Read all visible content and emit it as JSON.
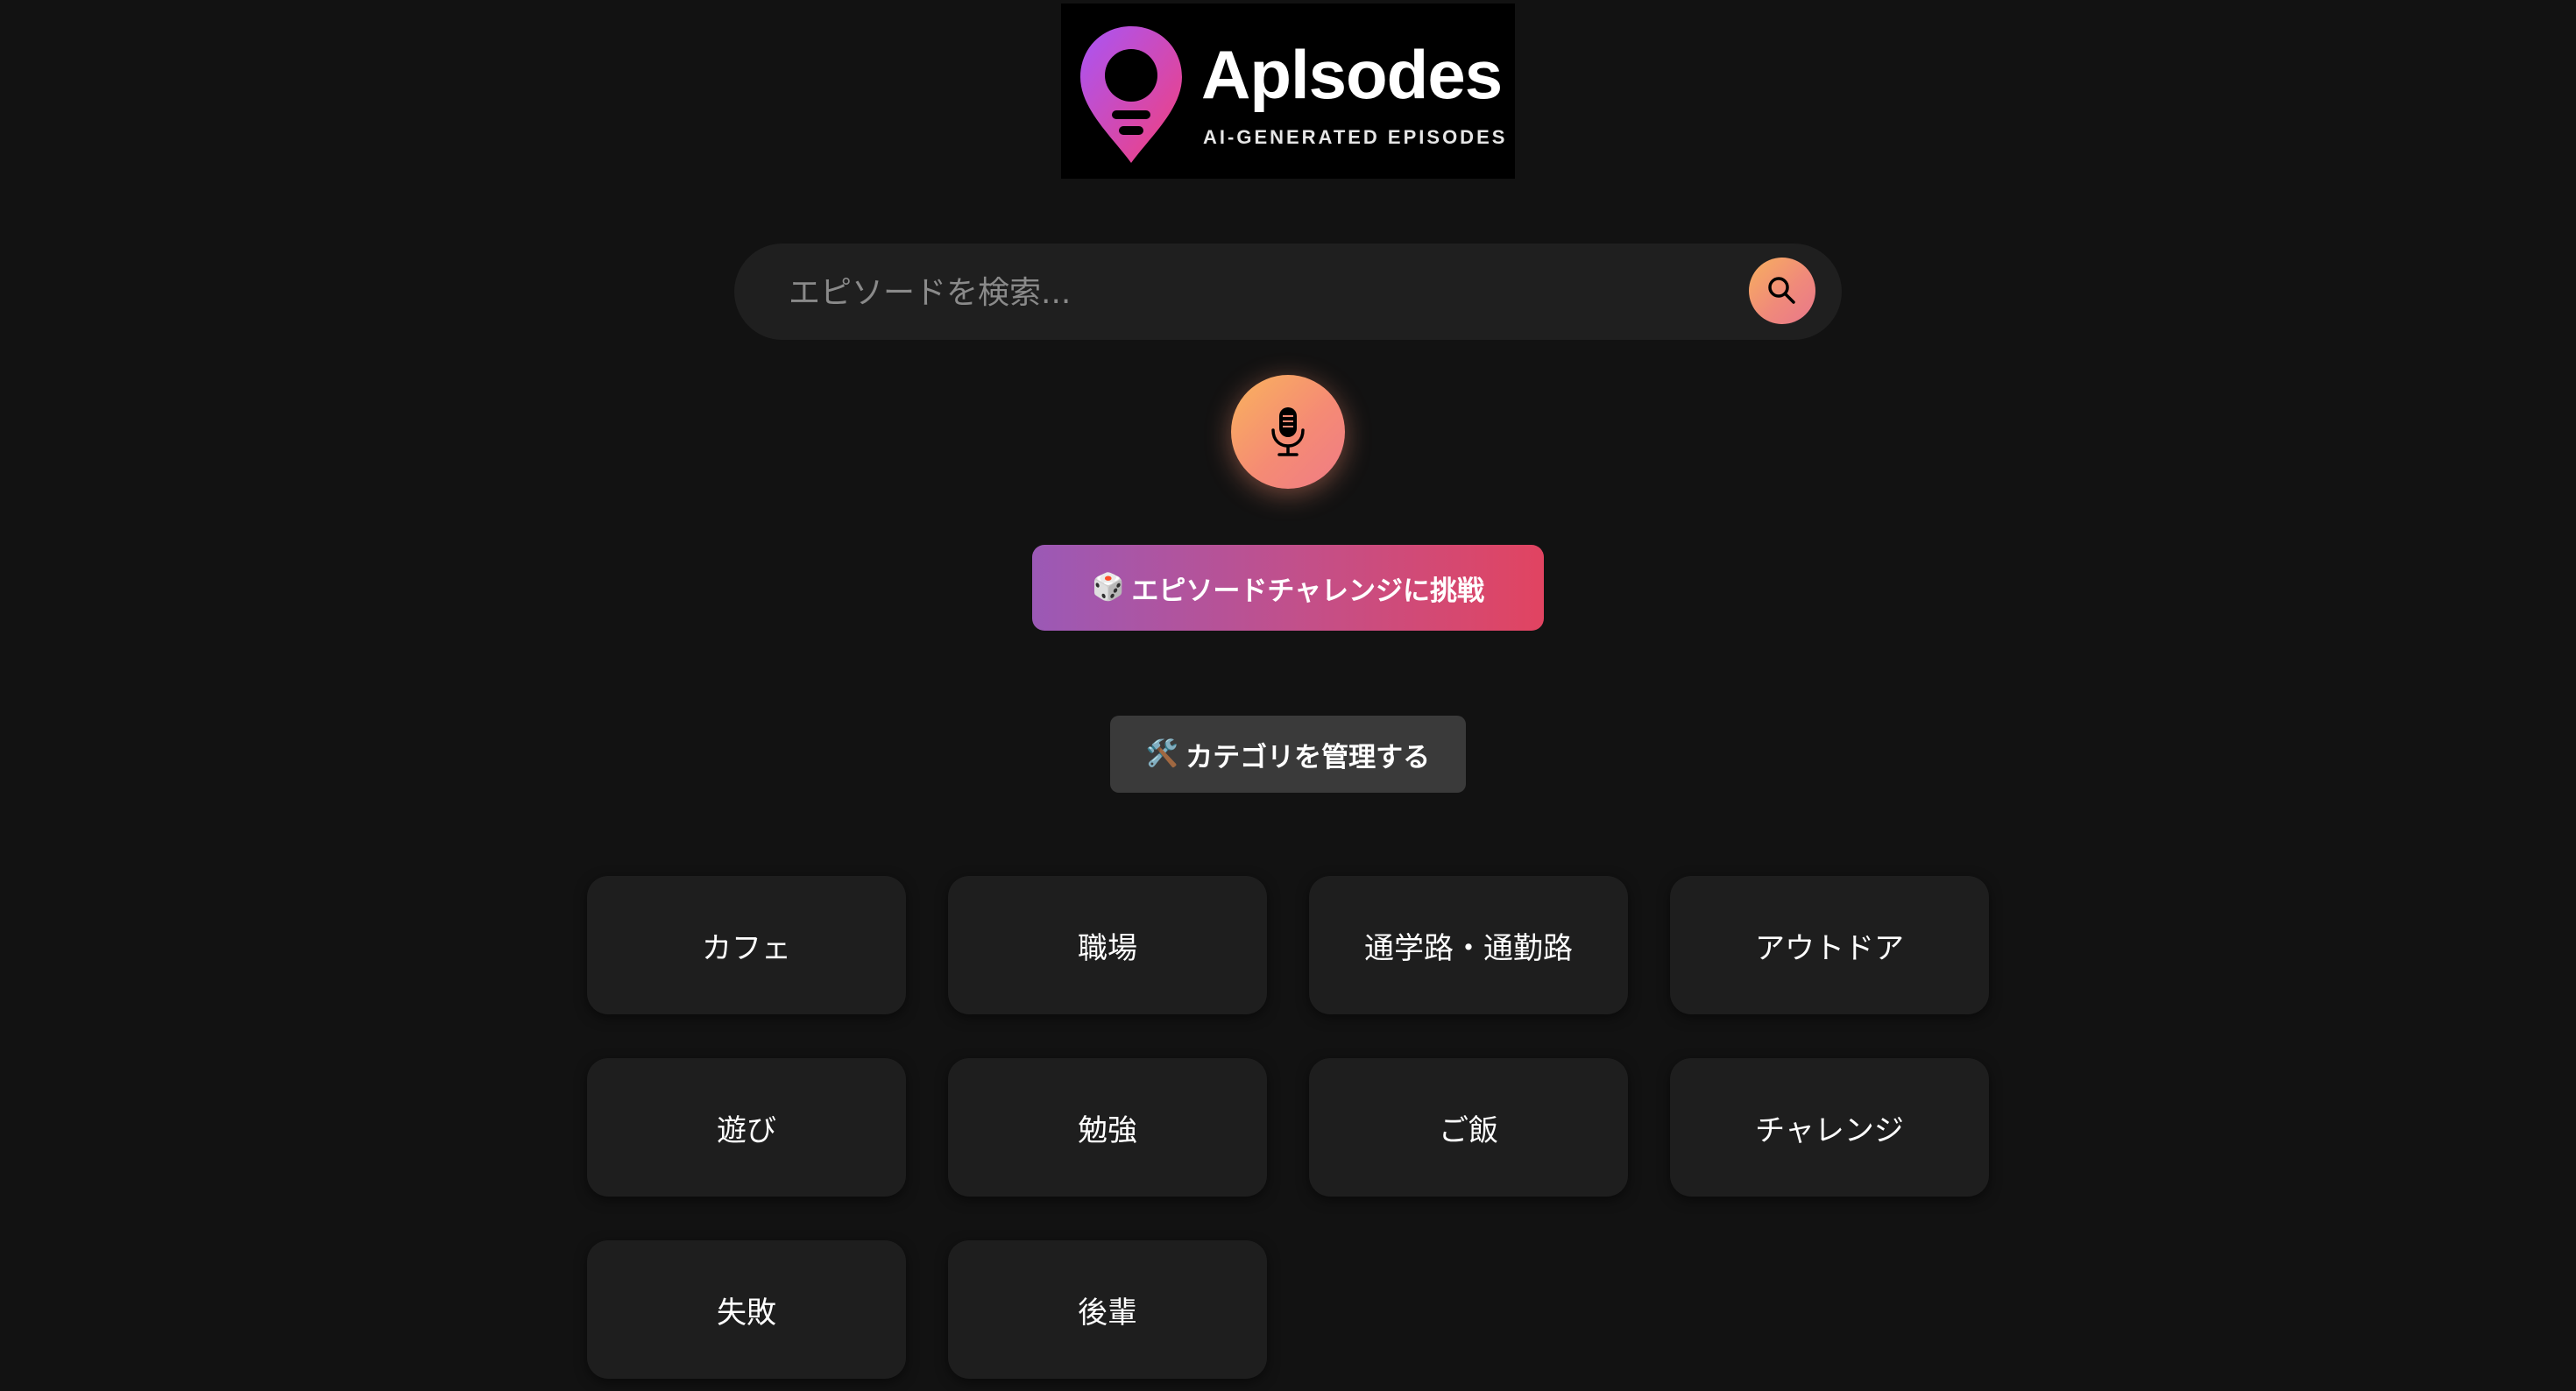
{
  "logo": {
    "title": "Aplsodes",
    "subtitle": "AI-GENERATED EPISODES",
    "colors": {
      "gradient_start": "#a855f7",
      "gradient_end": "#f43f7a"
    }
  },
  "search": {
    "placeholder": "エピソードを検索...",
    "value": "",
    "icon": "search-icon"
  },
  "mic": {
    "icon": "microphone-icon"
  },
  "challenge": {
    "icon": "🎲",
    "label": "エピソードチャレンジに挑戦"
  },
  "manage": {
    "icon": "🛠️",
    "label": "カテゴリを管理する"
  },
  "categories": [
    {
      "label": "カフェ"
    },
    {
      "label": "職場"
    },
    {
      "label": "通学路・通勤路"
    },
    {
      "label": "アウトドア"
    },
    {
      "label": "遊び"
    },
    {
      "label": "勉強"
    },
    {
      "label": "ご飯"
    },
    {
      "label": "チャレンジ"
    },
    {
      "label": "失敗"
    },
    {
      "label": "後輩"
    }
  ],
  "colors": {
    "background": "#121212",
    "card": "#1e1e1e",
    "accent_orange": "#f7a45e",
    "accent_pink": "#e14461",
    "accent_purple": "#9b59b6"
  }
}
